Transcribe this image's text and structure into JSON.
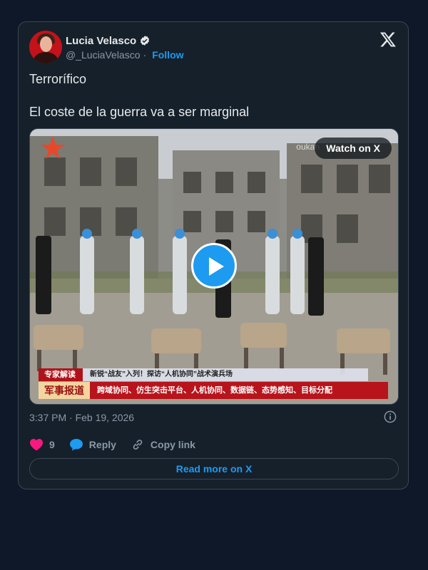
{
  "author": {
    "name": "Lucia Velasco",
    "handle": "@_LuciaVelasco",
    "separator": "·",
    "follow_label": "Follow"
  },
  "tweet": {
    "line1": "Terrorífico",
    "line2": "El coste de la guerra va a ser marginal"
  },
  "media": {
    "watch_label": "Watch on X",
    "watermark": "oukan",
    "caption_top_left": "专家解读",
    "caption_top_right": "新锐“战友”入列！探访“人机协同”战术演兵场",
    "caption_bottom_left": "军事报道",
    "caption_bottom_right": "跨域协同、仿生突击平台、人机协同、数据链、态势感知、目标分配"
  },
  "meta": {
    "timestamp": "3:37 PM · Feb 19, 2026"
  },
  "actions": {
    "like_count": "9",
    "reply_label": "Reply",
    "copy_label": "Copy link"
  },
  "read_more_label": "Read more on X",
  "colors": {
    "background": "#0f1828",
    "card": "#15202b",
    "accent": "#1d9bf0",
    "like": "#f91880",
    "muted": "#8b98a5"
  }
}
